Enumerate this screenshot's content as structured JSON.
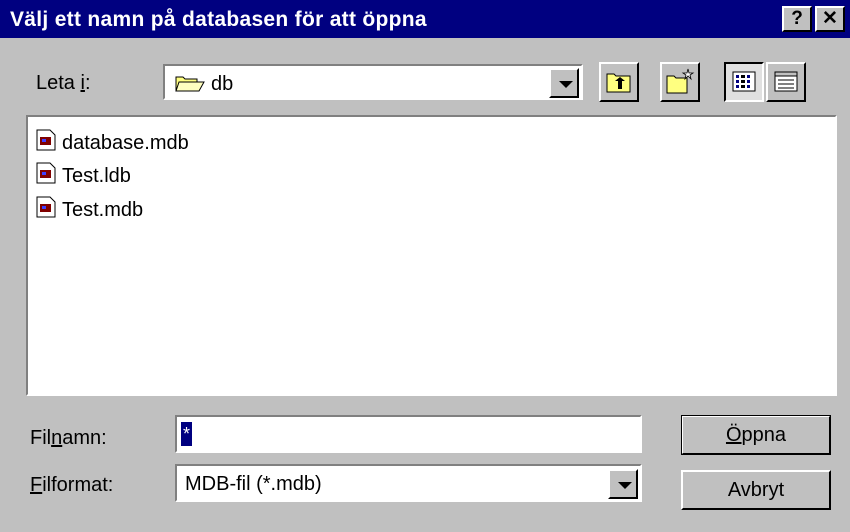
{
  "window": {
    "title": "Välj ett namn på databasen för att öppna",
    "help_glyph": "?",
    "close_glyph": "✕"
  },
  "lookin": {
    "label_pre": "Leta ",
    "label_u": "i",
    "label_post": ":",
    "value": "db"
  },
  "files": [
    {
      "name": "database.mdb"
    },
    {
      "name": "Test.ldb"
    },
    {
      "name": "Test.mdb"
    }
  ],
  "filename": {
    "label_pre": "Fil",
    "label_u": "n",
    "label_post": "amn:",
    "value": "*"
  },
  "filetype": {
    "label_u": "F",
    "label_post": "ilformat:",
    "value": "MDB-fil (*.mdb)"
  },
  "buttons": {
    "open_u": "Ö",
    "open_rest": "ppna",
    "cancel": "Avbryt"
  },
  "icons": {
    "folder": "folder-icon",
    "up": "up-one-level-icon",
    "new_folder": "new-folder-icon",
    "list_view": "list-view-icon",
    "details_view": "details-view-icon",
    "file": "access-database-file-icon"
  }
}
